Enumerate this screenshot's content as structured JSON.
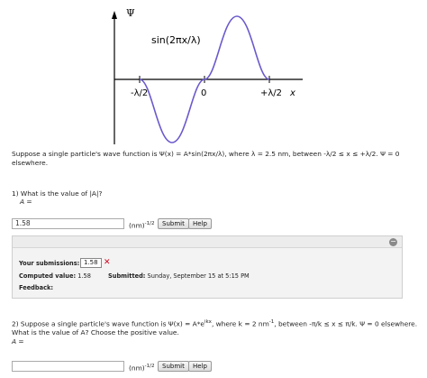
{
  "graph": {
    "y_axis_label": "Ψ",
    "x_axis_label": "x",
    "curve_label": "sin(2πx/λ)",
    "tick_left": "-λ/2",
    "tick_zero": "0",
    "tick_right": "+λ/2"
  },
  "problem": {
    "line1": "Suppose a single particle's wave function is Ψ(x) = A*sin(2πx/λ), where λ = 2.5 nm, between -λ/2 ≤ x ≤ +λ/2. Ψ = 0",
    "line2": "elsewhere."
  },
  "q1": {
    "question": "1) What is the value of |A|?",
    "answer_label": "A =",
    "input_value": "1.58",
    "unit": "(nm)",
    "unit_exp": "-1/2",
    "submit_label": "Submit",
    "help_label": "Help"
  },
  "feedback": {
    "collapse_symbol": "−",
    "your_submissions_label": "Your submissions:",
    "submission_value": "1.58",
    "wrong_mark": "✕",
    "computed_label": "Computed value:",
    "computed_value": "1.58",
    "submitted_label": "Submitted:",
    "submitted_value": "Sunday, September 15 at 5:15 PM",
    "feedback_label": "Feedback:"
  },
  "q2": {
    "line1_a": "2) Suppose a single particle's wave function is Ψ(x) = A*e",
    "line1_sup": "ikx",
    "line1_b": ", where k = 2 nm",
    "line1_sup2": "-1",
    "line1_c": ", between -π/k ≤ x ≤ π/k. Ψ = 0 elsewhere.",
    "line2": "What is the value of A? Choose the positive value.",
    "answer_label": "A =",
    "input_value": "",
    "unit": "(nm)",
    "unit_exp": "-1/2",
    "submit_label": "Submit",
    "help_label": "Help"
  },
  "colors": {
    "curve": "#6a5acd",
    "axis": "#000000",
    "wrong": "#d0021b"
  }
}
